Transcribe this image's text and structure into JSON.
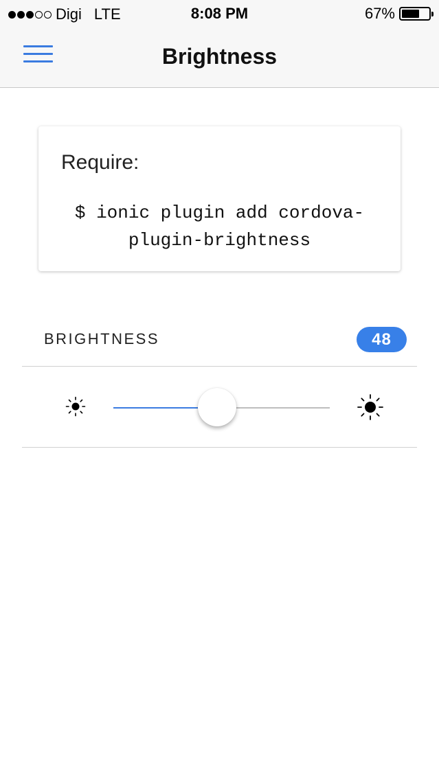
{
  "status_bar": {
    "signal_filled": 3,
    "signal_total": 5,
    "carrier": "Digi",
    "network": "LTE",
    "time": "8:08 PM",
    "battery_percent": "67%",
    "battery_level": 0.67
  },
  "nav": {
    "title": "Brightness",
    "menu_icon": "hamburger-menu-icon",
    "accent_color": "#3a7be0"
  },
  "card": {
    "title": "Require:",
    "code": "$ ionic plugin add cordova-plugin-brightness"
  },
  "brightness": {
    "label": "BRIGHTNESS",
    "value": "48",
    "slider_value": 48,
    "slider_min": 0,
    "slider_max": 100,
    "badge_color": "#3880e8",
    "min_icon": "sun-small-icon",
    "max_icon": "sun-large-icon"
  }
}
